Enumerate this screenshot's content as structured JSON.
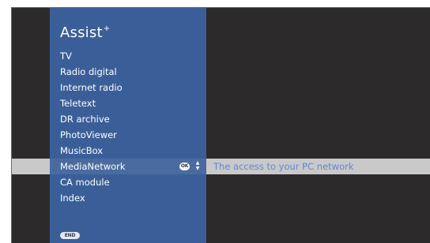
{
  "app": {
    "title": "Assist",
    "title_superscript": "+"
  },
  "menu": {
    "items": [
      {
        "label": "TV"
      },
      {
        "label": "Radio digital"
      },
      {
        "label": "Internet radio"
      },
      {
        "label": "Teletext"
      },
      {
        "label": "DR archive"
      },
      {
        "label": "PhotoViewer"
      },
      {
        "label": "MusicBox"
      },
      {
        "label": "MediaNetwork"
      },
      {
        "label": "CA module"
      },
      {
        "label": "Index"
      }
    ],
    "selected_index": 7,
    "selected_description": "The access to your PC network"
  },
  "buttons": {
    "ok_label": "OK",
    "end_label": "END"
  },
  "icons": {
    "ok": "ok-button-icon",
    "updown": "up-down-arrows-icon",
    "end": "end-button-icon"
  },
  "colors": {
    "background": "#2c2a2a",
    "panel": "#3a5f98",
    "highlight_bar": "#c9c9c9",
    "description_text": "#5b8ad3"
  }
}
